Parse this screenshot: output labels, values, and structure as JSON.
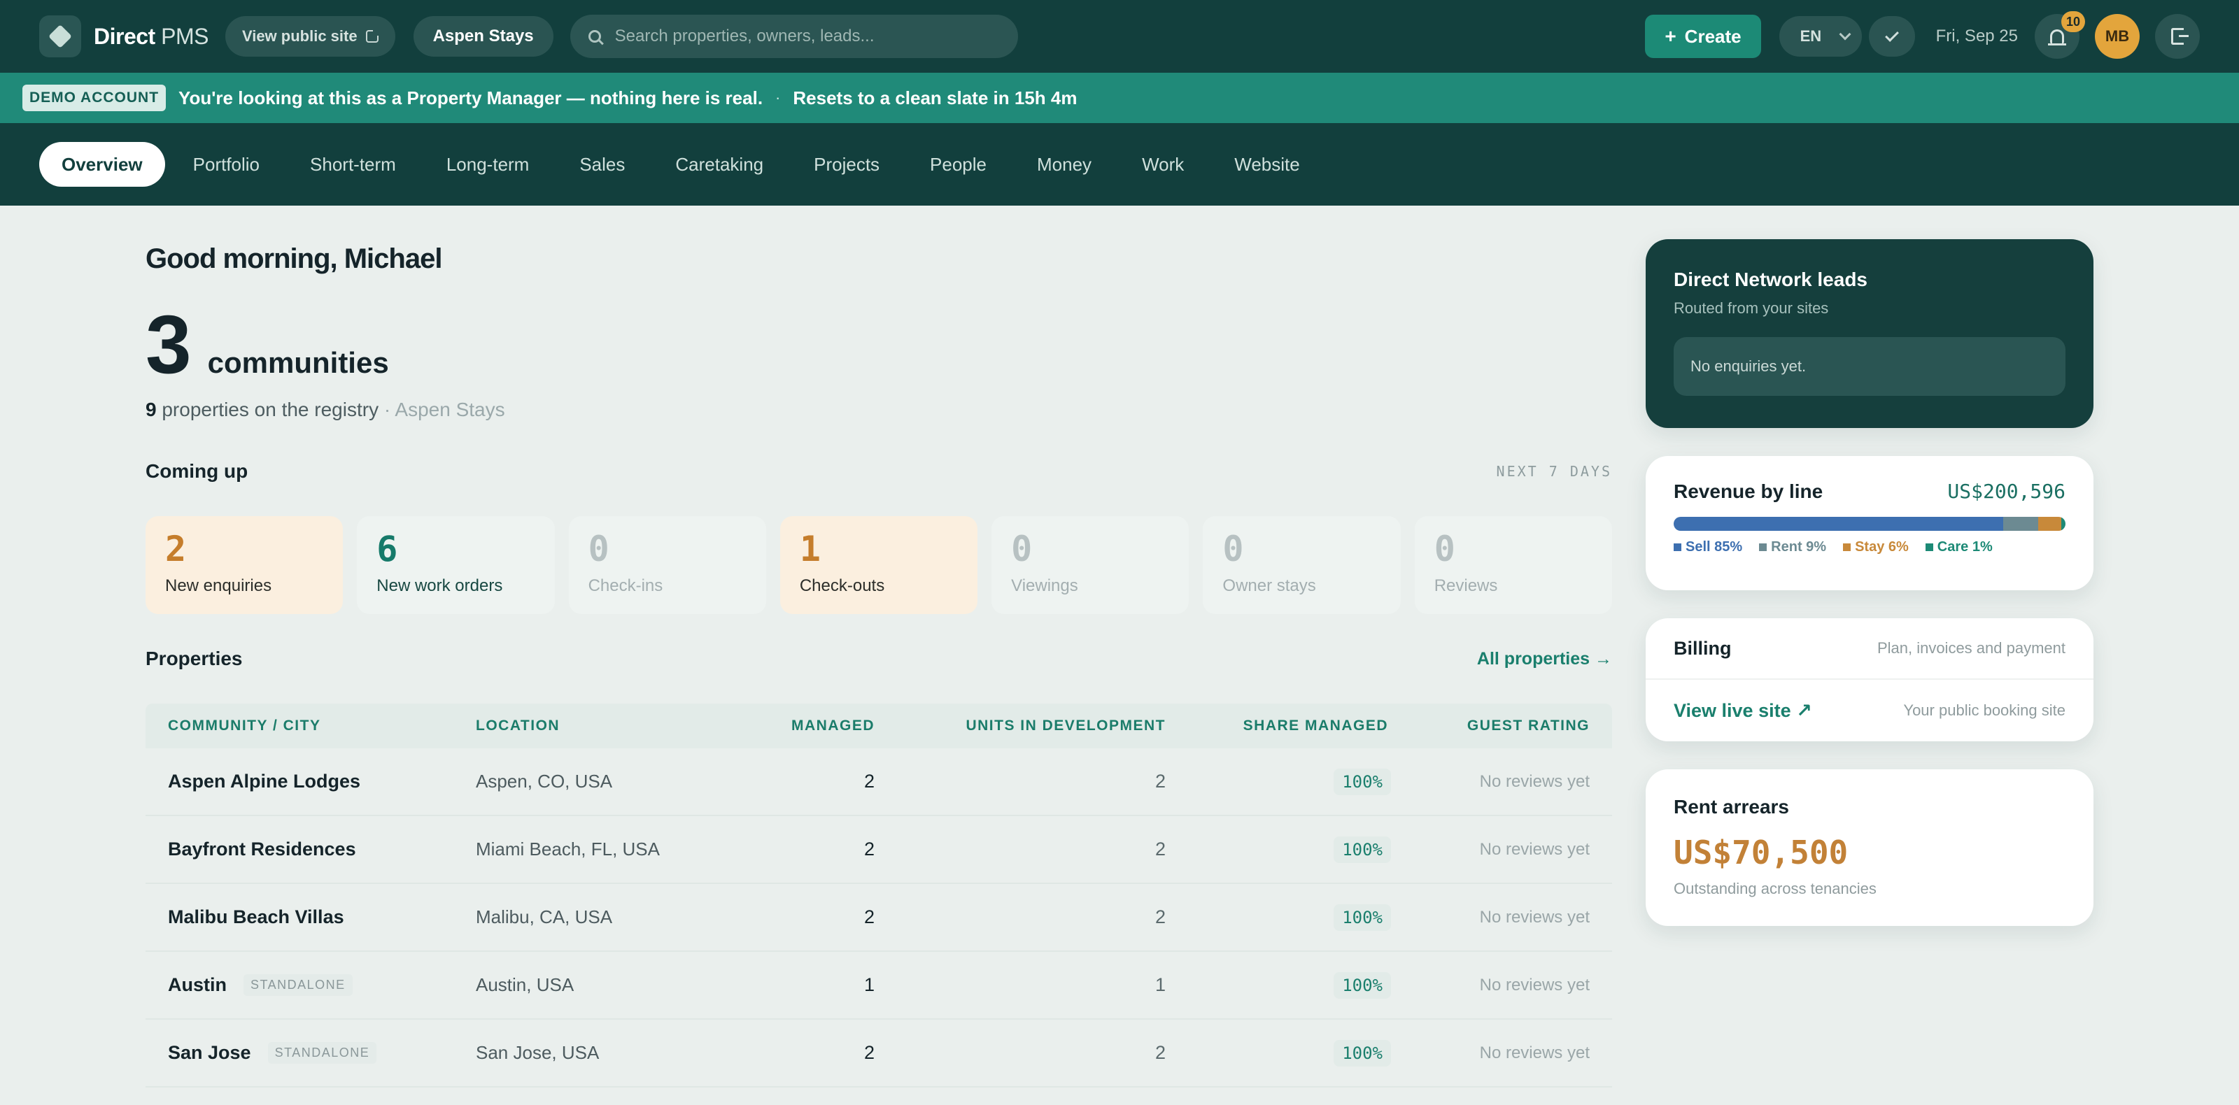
{
  "brand": {
    "name_bold": "Direct",
    "name_light": " PMS"
  },
  "topbar": {
    "view_public_site": "View public site",
    "workspace": "Aspen Stays",
    "search_placeholder": "Search properties, owners, leads...",
    "create_label": "Create",
    "language": "EN",
    "date": "Fri, Sep 25",
    "notifications_count": "10",
    "avatar_initials": "MB"
  },
  "demo_banner": {
    "tag": "DEMO ACCOUNT",
    "message": "You're looking at this as a Property Manager — nothing here is real.",
    "separator": "·",
    "reset": "Resets to a clean slate in 15h 4m"
  },
  "nav": {
    "items": [
      "Overview",
      "Portfolio",
      "Short-term",
      "Long-term",
      "Sales",
      "Caretaking",
      "Projects",
      "People",
      "Money",
      "Work",
      "Website"
    ],
    "active": "Overview"
  },
  "main": {
    "greeting": "Good morning, Michael",
    "count": "3",
    "count_label": "communities",
    "properties_count": "9",
    "properties_text": " properties on the registry",
    "properties_owner": "· Aspen Stays",
    "coming_up": {
      "title": "Coming up",
      "range": "NEXT 7 DAYS",
      "cards": [
        {
          "value": "2",
          "label": "New enquiries"
        },
        {
          "value": "6",
          "label": "New work orders"
        },
        {
          "value": "0",
          "label": "Check-ins"
        },
        {
          "value": "1",
          "label": "Check-outs"
        },
        {
          "value": "0",
          "label": "Viewings"
        },
        {
          "value": "0",
          "label": "Owner stays"
        },
        {
          "value": "0",
          "label": "Reviews"
        }
      ]
    },
    "properties": {
      "title": "Properties",
      "all_link": "All properties →",
      "columns": [
        "COMMUNITY / CITY",
        "LOCATION",
        "MANAGED",
        "UNITS IN DEVELOPMENT",
        "SHARE MANAGED",
        "GUEST RATING"
      ],
      "rows": [
        {
          "name": "Aspen Alpine Lodges",
          "tag": "",
          "location": "Aspen, CO, USA",
          "managed": "2",
          "units": "2",
          "share": "100%",
          "rating": "No reviews yet"
        },
        {
          "name": "Bayfront Residences",
          "tag": "",
          "location": "Miami Beach, FL, USA",
          "managed": "2",
          "units": "2",
          "share": "100%",
          "rating": "No reviews yet"
        },
        {
          "name": "Malibu Beach Villas",
          "tag": "",
          "location": "Malibu, CA, USA",
          "managed": "2",
          "units": "2",
          "share": "100%",
          "rating": "No reviews yet"
        },
        {
          "name": "Austin",
          "tag": "STANDALONE",
          "location": "Austin, USA",
          "managed": "1",
          "units": "1",
          "share": "100%",
          "rating": "No reviews yet"
        },
        {
          "name": "San Jose",
          "tag": "STANDALONE",
          "location": "San Jose, USA",
          "managed": "2",
          "units": "2",
          "share": "100%",
          "rating": "No reviews yet"
        }
      ]
    }
  },
  "side": {
    "network": {
      "title": "Direct Network leads",
      "subtitle": "Routed from your sites",
      "empty": "No enquiries yet."
    },
    "revenue": {
      "title": "Revenue by line",
      "total": "US$200,596",
      "segments": [
        {
          "label": "Sell 85%",
          "pct": 85,
          "color": "#3d6fb0"
        },
        {
          "label": "Rent 9%",
          "pct": 9,
          "color": "#6c8a92"
        },
        {
          "label": "Stay 6%",
          "pct": 6,
          "color": "#c8893a"
        },
        {
          "label": "Care 1%",
          "pct": 1,
          "color": "#1d8a76"
        }
      ]
    },
    "billing": {
      "title": "Billing",
      "desc": "Plan, invoices and payment",
      "live_link": "View live site ↗",
      "live_desc": "Your public booking site"
    },
    "arrears": {
      "title": "Rent arrears",
      "amount": "US$70,500",
      "subtitle": "Outstanding across tenancies"
    }
  }
}
